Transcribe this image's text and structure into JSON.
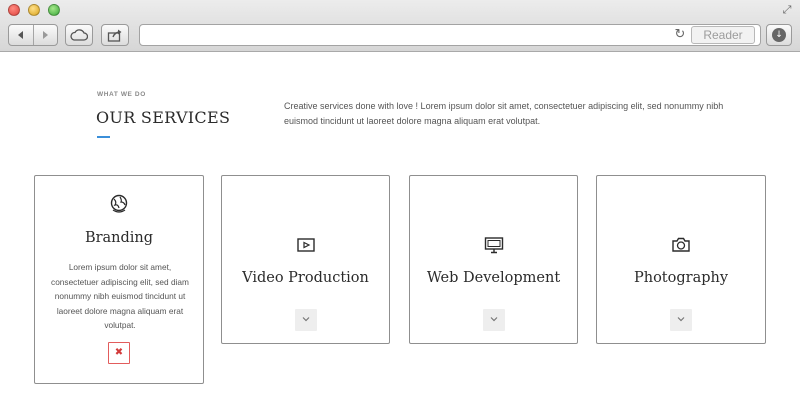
{
  "browser": {
    "reader_label": "Reader",
    "address_value": ""
  },
  "section": {
    "eyebrow": "WHAT WE DO",
    "title": "OUR SERVICES",
    "intro": "Creative services done with love ! Lorem ipsum dolor sit amet, consectetuer adipiscing elit, sed nonummy nibh euismod tincidunt ut laoreet dolore magna aliquam erat volutpat."
  },
  "services": [
    {
      "title": "Branding",
      "icon": "globe-icon",
      "expanded": true,
      "text": "Lorem ipsum dolor sit amet, consectetuer adipiscing elit, sed diam nonummy nibh euismod tincidunt ut laoreet dolore magna aliquam erat volutpat.",
      "toggle_glyph": "✖"
    },
    {
      "title": "Video Production",
      "icon": "video-play-icon",
      "expanded": false,
      "toggle_glyph": "⌄"
    },
    {
      "title": "Web Development",
      "icon": "monitor-icon",
      "expanded": false,
      "toggle_glyph": "⌄"
    },
    {
      "title": "Photography",
      "icon": "camera-icon",
      "expanded": false,
      "toggle_glyph": "⌄"
    }
  ],
  "colors": {
    "accent": "#3b8fd9",
    "close_red": "#e25c5c"
  }
}
